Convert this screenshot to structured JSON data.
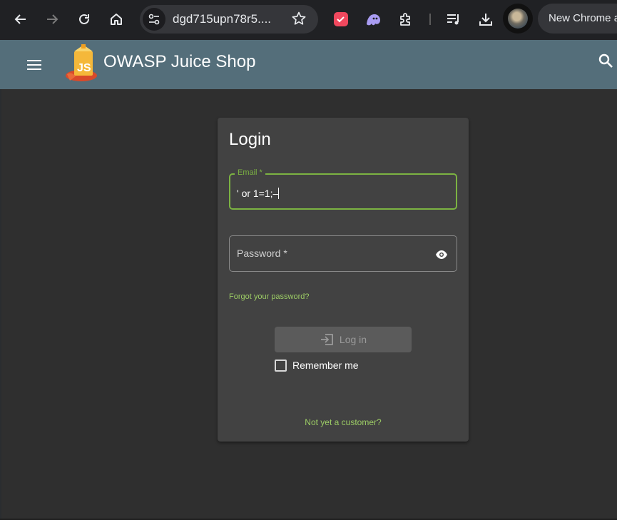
{
  "browser": {
    "url": "dgd715upn78r5....",
    "new_chrome_label": "New Chrome a"
  },
  "toolbar": {
    "app_title": "OWASP Juice Shop"
  },
  "login": {
    "title": "Login",
    "email_label": "Email *",
    "email_value": "' or 1=1;–",
    "password_label": "Password *",
    "forgot_link": "Forgot your password?",
    "login_button": "Log in",
    "login_button_enabled": false,
    "remember_label": "Remember me",
    "remember_checked": false,
    "register_link": "Not yet a customer?"
  },
  "colors": {
    "toolbar": "#546e7a",
    "page_background": "#2f2f2f",
    "card": "#424242",
    "accent": "#7cb342",
    "link": "#9ccc65"
  },
  "icons": [
    "back-icon",
    "forward-icon",
    "reload-icon",
    "home-icon",
    "site-settings-icon",
    "star-icon",
    "extension-calendar-icon",
    "extension-ghost-icon",
    "extensions-puzzle-icon",
    "media-queue-icon",
    "download-icon",
    "profile-avatar",
    "menu-icon",
    "juice-shop-logo",
    "search-icon",
    "visibility-icon",
    "login-icon"
  ]
}
